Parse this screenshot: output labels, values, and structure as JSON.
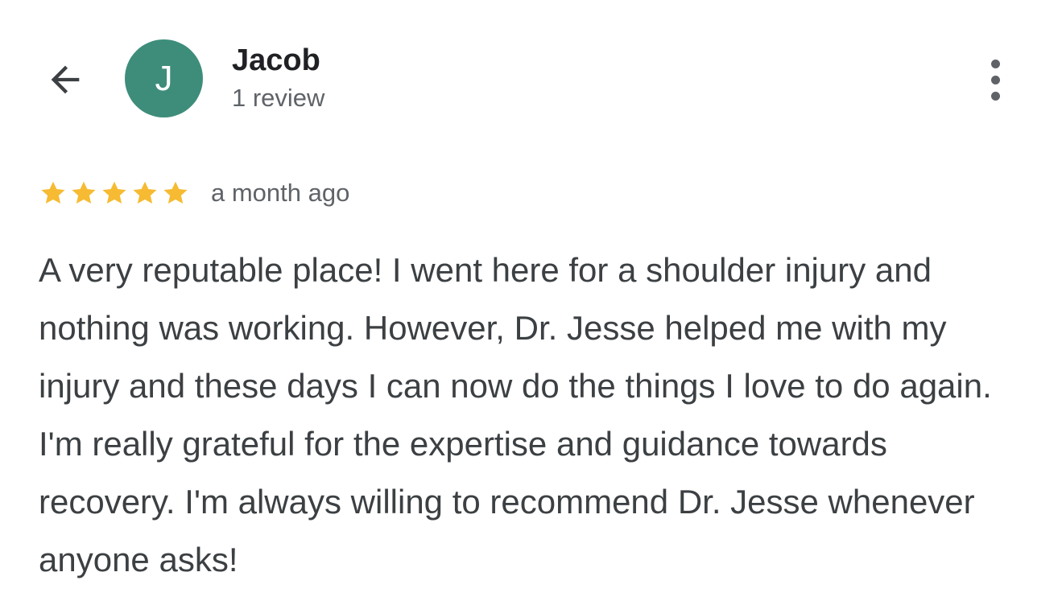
{
  "header": {
    "back_icon": "arrow-left-icon",
    "avatar_letter": "J",
    "avatar_color": "#3d8d7a",
    "reviewer_name": "Jacob",
    "review_count": "1 review",
    "more_icon": "more-vertical-icon"
  },
  "review": {
    "rating": 5,
    "max_rating": 5,
    "star_color": "#f6bb32",
    "time_ago": "a month ago",
    "text": "A very reputable place! I went here for a shoulder injury and nothing was working. However, Dr. Jesse helped me with my injury and these days I can now do the things I love to do again. I'm really grateful for the expertise and guidance towards recovery. I'm always willing to recommend Dr. Jesse whenever anyone asks!"
  }
}
